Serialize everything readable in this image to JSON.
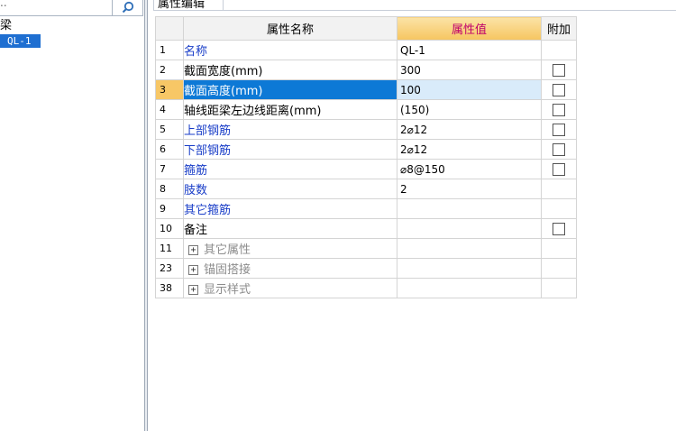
{
  "left_panel": {
    "search_text": "..",
    "tree_root": "梁",
    "tree_item": "QL-1"
  },
  "tab": {
    "label": "属性编辑"
  },
  "grid": {
    "headers": {
      "name": "属性名称",
      "value": "属性值",
      "extra": "附加"
    },
    "rows": [
      {
        "num": "1",
        "name": "名称",
        "value": "QL-1"
      },
      {
        "num": "2",
        "name": "截面宽度(mm)",
        "value": "300"
      },
      {
        "num": "3",
        "name": "截面高度(mm)",
        "value": "100"
      },
      {
        "num": "4",
        "name": "轴线距梁左边线距离(mm)",
        "value": "(150)"
      },
      {
        "num": "5",
        "name": "上部钢筋",
        "value": "2⌀12"
      },
      {
        "num": "6",
        "name": "下部钢筋",
        "value": "2⌀12"
      },
      {
        "num": "7",
        "name": "箍筋",
        "value": "⌀8@150"
      },
      {
        "num": "8",
        "name": "肢数",
        "value": "2"
      },
      {
        "num": "9",
        "name": "其它箍筋",
        "value": ""
      },
      {
        "num": "10",
        "name": "备注",
        "value": ""
      },
      {
        "num": "11",
        "name": "其它属性",
        "value": ""
      },
      {
        "num": "23",
        "name": "锚固搭接",
        "value": ""
      },
      {
        "num": "38",
        "name": "显示样式",
        "value": ""
      }
    ]
  },
  "colors": {
    "selection": "#0d79d6",
    "header_accent": "#f6c560",
    "link_blue": "#1a3ec8"
  },
  "icons": {
    "search": "search-icon",
    "expand": "plus-box-icon",
    "checkbox": "checkbox-icon"
  }
}
